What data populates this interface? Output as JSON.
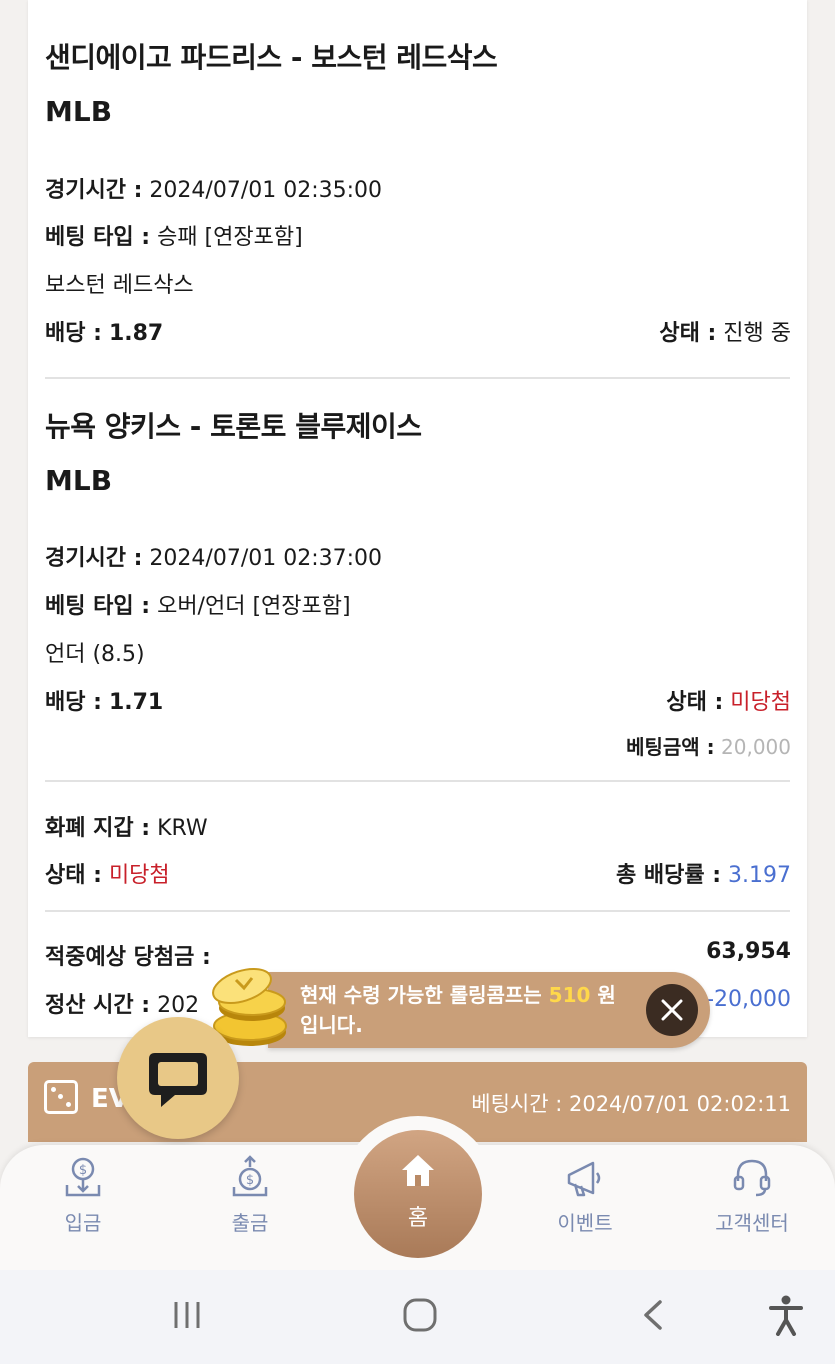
{
  "bets": [
    {
      "match": "샌디에이고 파드리스 - 보스턴 레드삭스",
      "league": "MLB",
      "time_label": "경기시간 :",
      "time_value": "2024/07/01 02:35:00",
      "type_label": "베팅 타입 :",
      "type_value": "승패 [연장포함]",
      "pick": "보스턴 레드삭스",
      "odds_label": "배당 :",
      "odds_value": "1.87",
      "status_label": "상태 :",
      "status_value": "진행 중"
    },
    {
      "match": "뉴욕 양키스 - 토론토 블루제이스",
      "league": "MLB",
      "time_label": "경기시간 :",
      "time_value": "2024/07/01 02:37:00",
      "type_label": "베팅 타입 :",
      "type_value": "오버/언더 [연장포함]",
      "pick": "언더 (8.5)",
      "odds_label": "배당 :",
      "odds_value": "1.71",
      "status_label": "상태 :",
      "status_value": "미당첨",
      "amount_label": "베팅금액 :",
      "amount_value": "20,000"
    }
  ],
  "summary": {
    "wallet_label": "화폐 지갑 :",
    "wallet_value": "KRW",
    "status_label": "상태 :",
    "status_value": "미당첨",
    "total_odds_label": "총 배당률 :",
    "total_odds_value": "3.197",
    "expected_label": "적중예상 당첨금 :",
    "expected_value": "63,954",
    "settle_label": "정산 시간 :",
    "settle_value_partial": "202",
    "settle_amount": "-20,000"
  },
  "toast": {
    "text_pre": "현재 수령 가능한 롤링콤프는",
    "amount": "510",
    "text_post": "원 입니다."
  },
  "event_bar": {
    "label": "EV",
    "bet_time": "베팅시간 : 2024/07/01 02:02:11"
  },
  "nav": {
    "deposit": "입금",
    "withdraw": "출금",
    "home": "홈",
    "event": "이벤트",
    "support": "고객센터"
  },
  "colors": {
    "accent": "#c99f79",
    "lose": "#c8202a",
    "odds": "#4a6fd0",
    "chat": "#e8c887"
  }
}
